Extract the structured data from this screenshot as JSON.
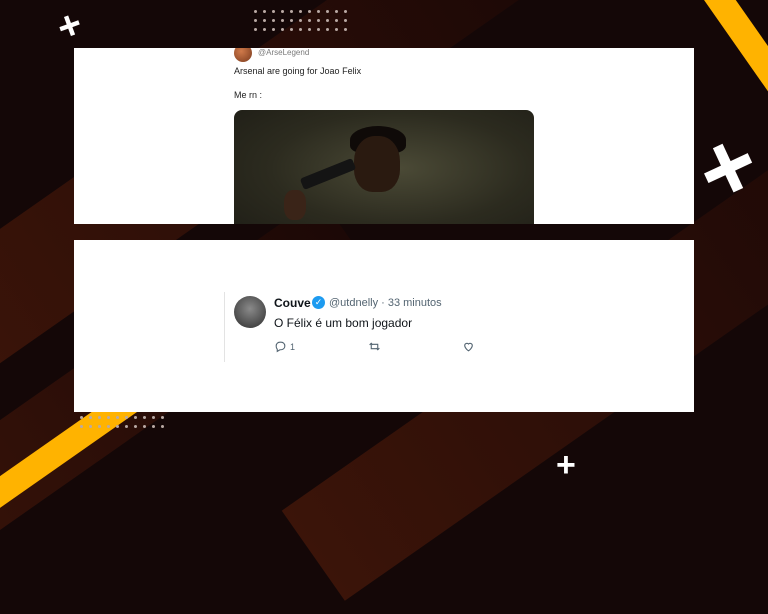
{
  "top_tweet": {
    "handle": "@ArseLegend",
    "text": "Arsenal are going for Joao Felix",
    "caption": "Me rn :"
  },
  "reply_tweet": {
    "name": "Couve",
    "handle_time": "@utdnelly · 33 minutos",
    "text": "O Félix é um bom jogador",
    "reply_count": "1"
  },
  "icons": [
    "reply-icon",
    "retweet-icon",
    "like-icon",
    "verified-icon"
  ],
  "colors": {
    "accent_yellow": "#ffb300",
    "verified_blue": "#1d9bf0"
  }
}
